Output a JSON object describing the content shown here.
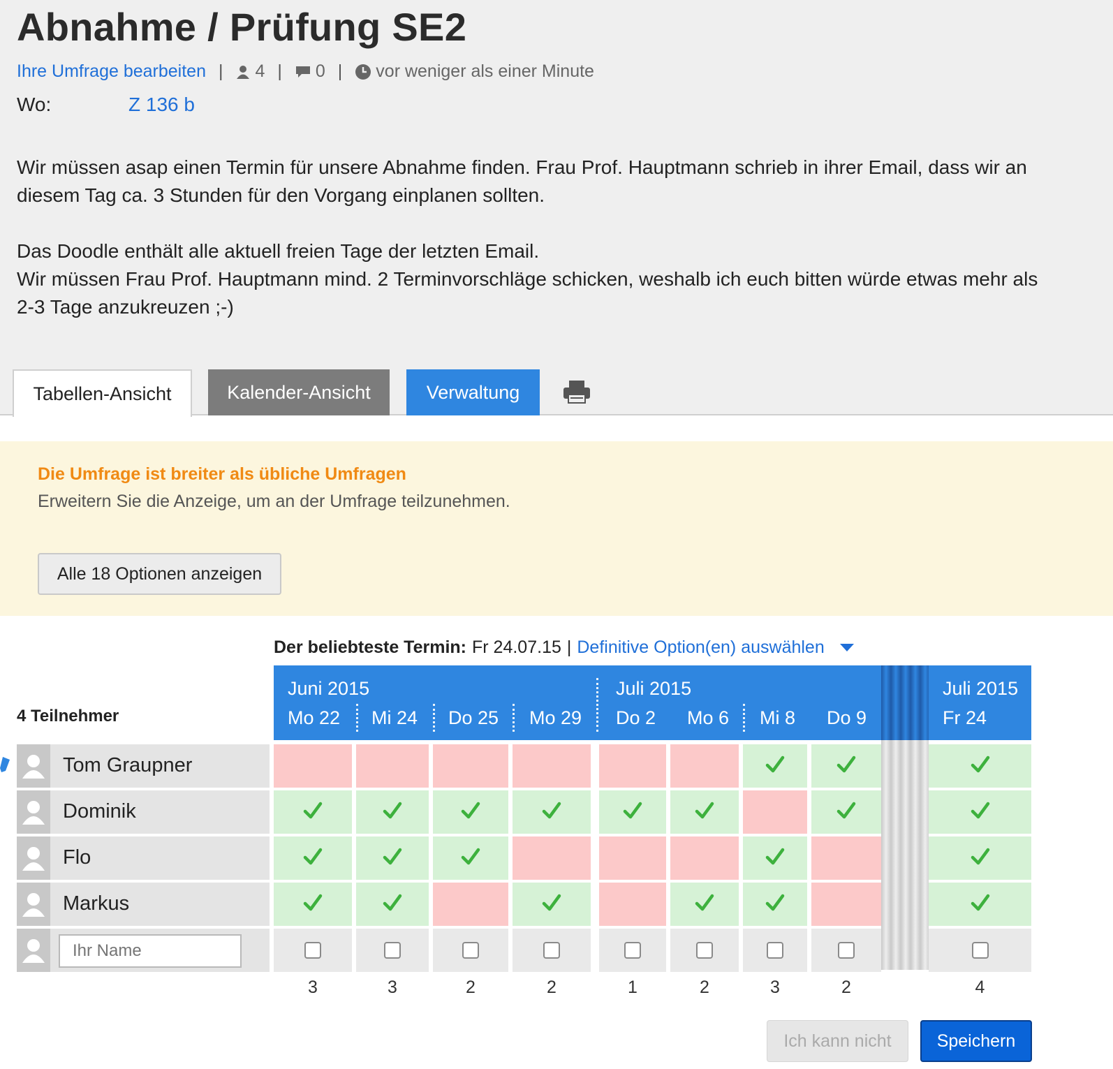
{
  "poll": {
    "title": "Abnahme / Prüfung SE2",
    "edit_link": "Ihre Umfrage bearbeiten",
    "participants_count": "4",
    "comments_count": "0",
    "updated": "vor weniger als einer Minute",
    "where_label": "Wo:",
    "where_value": "Z 136 b",
    "description_lines": [
      "Wir müssen asap einen Termin für unsere Abnahme finden. Frau Prof. Hauptmann schrieb in ihrer Email, dass wir an",
      "diesem Tag ca. 3 Stunden für den Vorgang einplanen sollten.",
      "",
      "Das Doodle enthält alle aktuell freien Tage der letzten Email.",
      "Wir müssen Frau Prof. Hauptmann mind. 2 Terminvorschläge schicken, weshalb ich euch bitten würde etwas mehr als",
      "2-3 Tage anzukreuzen ;-)"
    ]
  },
  "tabs": {
    "table": "Tabellen-Ansicht",
    "calendar": "Kalender-Ansicht",
    "admin": "Verwaltung",
    "print_icon": "printer-icon"
  },
  "notice": {
    "title": "Die Umfrage ist breiter als übliche Umfragen",
    "text": "Erweitern Sie die Anzeige, um an der Umfrage teilzunehmen.",
    "button": "Alle 18 Optionen anzeigen"
  },
  "popular": {
    "label": "Der beliebteste Termin:",
    "value": "Fr 24.07.15",
    "separator": "|",
    "link": "Definitive Option(en) auswählen"
  },
  "participants_label": "4 Teilnehmer",
  "months": [
    {
      "label": "Juni 2015"
    },
    {
      "label": "Juli 2015"
    },
    {
      "label": "Juli 2015"
    }
  ],
  "options": [
    {
      "day": "Mo 22",
      "total": "3"
    },
    {
      "day": "Mi 24",
      "total": "3"
    },
    {
      "day": "Do 25",
      "total": "2"
    },
    {
      "day": "Mo 29",
      "total": "2"
    },
    {
      "day": "Do 2",
      "total": "1"
    },
    {
      "day": "Mo 6",
      "total": "2"
    },
    {
      "day": "Mi 8",
      "total": "3"
    },
    {
      "day": "Do 9",
      "total": "2"
    },
    {
      "day": "Fr 24",
      "total": "4"
    }
  ],
  "participants": [
    {
      "name": "Tom Graupner",
      "votes": [
        "no",
        "no",
        "no",
        "no",
        "no",
        "no",
        "yes",
        "yes",
        "yes"
      ]
    },
    {
      "name": "Dominik",
      "votes": [
        "yes",
        "yes",
        "yes",
        "yes",
        "yes",
        "yes",
        "no",
        "yes",
        "yes"
      ]
    },
    {
      "name": "Flo",
      "votes": [
        "yes",
        "yes",
        "yes",
        "no",
        "no",
        "no",
        "yes",
        "no",
        "yes"
      ]
    },
    {
      "name": "Markus",
      "votes": [
        "yes",
        "yes",
        "no",
        "yes",
        "no",
        "yes",
        "yes",
        "no",
        "yes"
      ]
    }
  ],
  "new_row": {
    "placeholder": "Ihr Name"
  },
  "buttons": {
    "cant": "Ich kann nicht",
    "save": "Speichern"
  },
  "colors": {
    "accent": "#2f86e0",
    "yes": "#d6f2d6",
    "no": "#fcc9c9",
    "check": "#3db13d",
    "notice_title": "#f08a14"
  }
}
